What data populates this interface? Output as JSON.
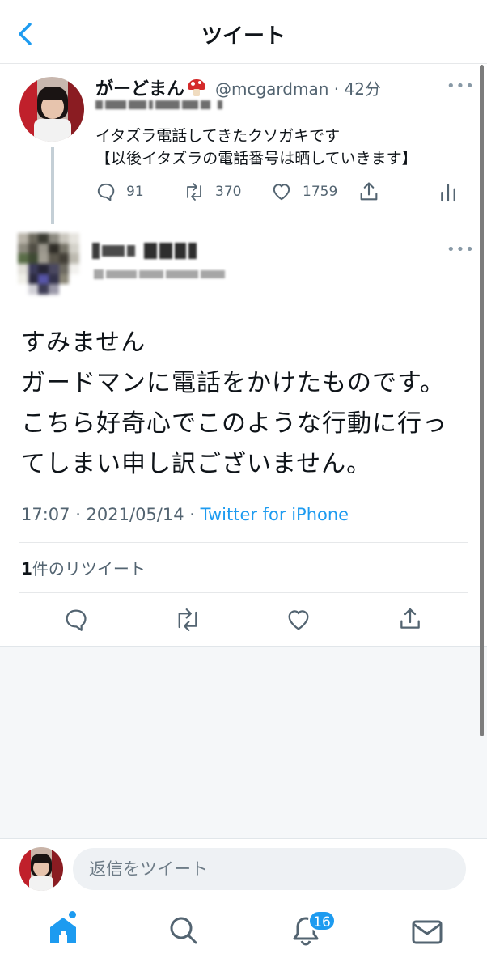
{
  "header": {
    "title": "ツイート"
  },
  "quoted_tweet": {
    "author_name": "がーどまん",
    "handle_time": "@mcgardman · 42分",
    "text_lines": [
      "イタズラ電話してきたクソガキです",
      "【以後イタズラの電話番号は晒していきます】"
    ],
    "stats": {
      "replies": "91",
      "retweets": "370",
      "likes": "1759"
    }
  },
  "main_tweet": {
    "body_lines": [
      "すみません",
      "ガードマンに電話をかけたものです。",
      "こちら好奇心でこのような行動に行っ",
      "てしまい申し訳ございません。"
    ],
    "meta_time": "17:07 · 2021/05/14 · ",
    "meta_source": "Twitter for iPhone",
    "retweet_count": "1",
    "retweet_label": "件のリツイート"
  },
  "reply_bar": {
    "placeholder": "返信をツイート"
  },
  "tab_bar": {
    "notifications_badge": "16"
  },
  "colors": {
    "accent": "#1d9bf0",
    "text": "#0f1419",
    "secondary": "#536471"
  }
}
